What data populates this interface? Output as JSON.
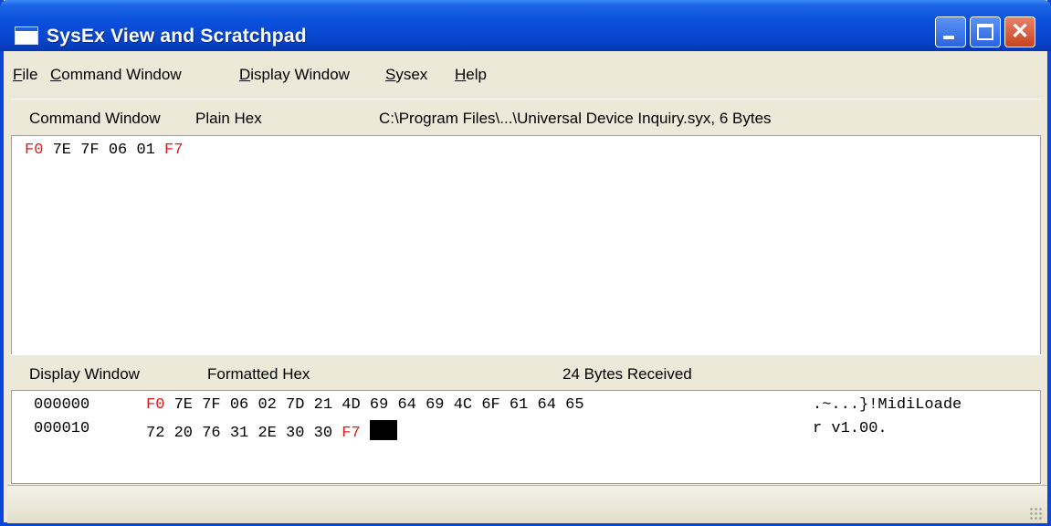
{
  "window": {
    "title": "SysEx View and Scratchpad"
  },
  "menu": {
    "items": [
      {
        "label": "File",
        "ul": "F",
        "rest": "ile"
      },
      {
        "label": "Command Window",
        "ul": "C",
        "rest": "ommand Window"
      },
      {
        "label": "Display Window",
        "ul": "D",
        "rest": "isplay Window"
      },
      {
        "label": "Sysex",
        "ul": "S",
        "rest": "ysex"
      },
      {
        "label": "Help",
        "ul": "H",
        "rest": "elp"
      }
    ]
  },
  "command_panel": {
    "name": "Command Window",
    "format": "Plain Hex",
    "file_info": "C:\\Program Files\\...\\Universal Device Inquiry.syx,  6 Bytes",
    "bytes": [
      "F0",
      "7E",
      "7F",
      "06",
      "01",
      "F7"
    ]
  },
  "display_panel": {
    "name": "Display Window",
    "format": "Formatted Hex",
    "status": "24  Bytes Received",
    "rows": [
      {
        "offset": "000000",
        "bytes": [
          "F0",
          "7E",
          "7F",
          "06",
          "02",
          "7D",
          "21",
          "4D",
          "69",
          "64",
          "69",
          "4C",
          "6F",
          "61",
          "64",
          "65"
        ],
        "ascii": ".~...}!MidiLoade"
      },
      {
        "offset": "000010",
        "bytes": [
          "72",
          "20",
          "76",
          "31",
          "2E",
          "30",
          "30",
          "F7"
        ],
        "ascii": "r v1.00."
      }
    ]
  },
  "colors": {
    "sysex_delimiter": "#E01A1A",
    "title_bar": "#0A4FDC",
    "window_bg": "#ECE9D8"
  },
  "icons": [
    "app-window-icon",
    "minimize-icon",
    "maximize-icon",
    "close-icon",
    "resize-grip-icon"
  ]
}
